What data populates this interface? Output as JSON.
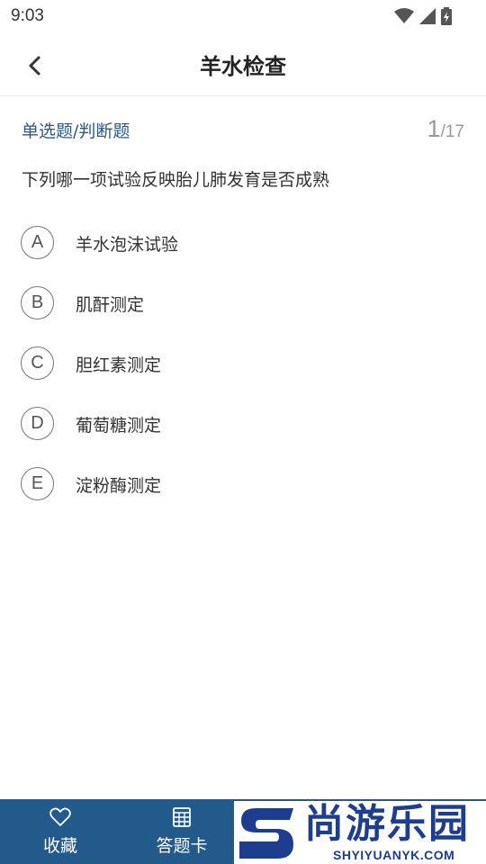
{
  "status_bar": {
    "time": "9:03",
    "icons": [
      "wifi-icon",
      "signal-icon",
      "battery-icon"
    ]
  },
  "header": {
    "title": "羊水检查",
    "back_icon": "back-arrow-icon"
  },
  "question": {
    "type": "单选题/判断题",
    "current": "1",
    "separator": "/",
    "total": "17",
    "text": "下列哪一项试验反映胎儿肺发育是否成熟",
    "options": [
      {
        "letter": "A",
        "text": "羊水泡沫试验"
      },
      {
        "letter": "B",
        "text": "肌酐测定"
      },
      {
        "letter": "C",
        "text": "胆红素测定"
      },
      {
        "letter": "D",
        "text": "葡萄糖测定"
      },
      {
        "letter": "E",
        "text": "淀粉酶测定"
      }
    ]
  },
  "bottom_nav": {
    "favorite": {
      "label": "收藏",
      "icon": "heart-icon"
    },
    "answer_card": {
      "label": "答题卡",
      "icon": "grid-icon"
    }
  },
  "watermark": {
    "title": "尚游乐园",
    "subtitle": "SHYIYUANYK.COM"
  },
  "colors": {
    "accent": "#235a8c",
    "question_type": "#2a5a8c",
    "watermark": "#1d3d8f"
  }
}
